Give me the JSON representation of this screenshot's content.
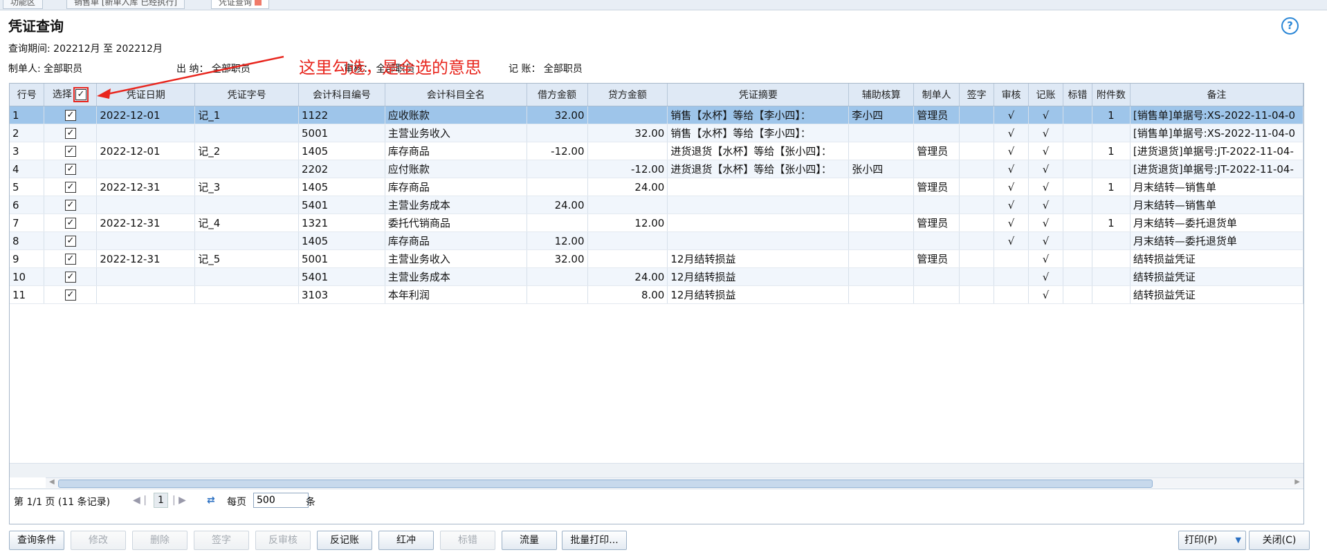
{
  "tabs": [
    {
      "label": "功能区"
    },
    {
      "label": "销售单 [新单入库 已经执行]"
    },
    {
      "label": "凭证查询"
    }
  ],
  "page_title": "凭证查询",
  "filters": {
    "period_label": "查询期间:",
    "period_value": "202212月 至 202212月",
    "maker_label": "制单人:",
    "maker_value": "全部职员",
    "cashier_label": "出 纳：",
    "cashier_value": "全部职员",
    "auditor_label": "审核：",
    "auditor_value": "全部职员",
    "poster_label": "记 账：",
    "poster_value": "全部职员"
  },
  "annotation": "这里勾选，是全选的意思",
  "colors": {
    "annotation": "#e8261e",
    "selected_row": "#9ec5ea",
    "header_bg": "#dfe9f5"
  },
  "columns": [
    "行号",
    "选择",
    "凭证日期",
    "凭证字号",
    "会计科目编号",
    "会计科目全名",
    "借方金额",
    "贷方金额",
    "凭证摘要",
    "辅助核算",
    "制单人",
    "签字",
    "审核",
    "记账",
    "标错",
    "附件数",
    "备注"
  ],
  "rows": [
    {
      "no": "1",
      "date": "2022-12-01",
      "voucher": "记_1",
      "code": "1122",
      "account": "应收账款",
      "debit": "32.00",
      "credit": "",
      "summary": "销售【水杯】等给【李小四】：",
      "aux": "李小四",
      "maker": "管理员",
      "sign": "",
      "audit": "√",
      "post": "√",
      "err": "",
      "attach": "1",
      "note": "[销售单]单据号:XS-2022-11-04-0"
    },
    {
      "no": "2",
      "date": "",
      "voucher": "",
      "code": "5001",
      "account": "主营业务收入",
      "debit": "",
      "credit": "32.00",
      "summary": "销售【水杯】等给【李小四】：",
      "aux": "",
      "maker": "",
      "sign": "",
      "audit": "√",
      "post": "√",
      "err": "",
      "attach": "",
      "note": "[销售单]单据号:XS-2022-11-04-0"
    },
    {
      "no": "3",
      "date": "2022-12-01",
      "voucher": "记_2",
      "code": "1405",
      "account": "库存商品",
      "debit": "-12.00",
      "credit": "",
      "summary": "进货退货【水杯】等给【张小四】：",
      "aux": "",
      "maker": "管理员",
      "sign": "",
      "audit": "√",
      "post": "√",
      "err": "",
      "attach": "1",
      "note": "[进货退货]单据号:JT-2022-11-04-"
    },
    {
      "no": "4",
      "date": "",
      "voucher": "",
      "code": "2202",
      "account": "应付账款",
      "debit": "",
      "credit": "-12.00",
      "summary": "进货退货【水杯】等给【张小四】：",
      "aux": "张小四",
      "maker": "",
      "sign": "",
      "audit": "√",
      "post": "√",
      "err": "",
      "attach": "",
      "note": "[进货退货]单据号:JT-2022-11-04-"
    },
    {
      "no": "5",
      "date": "2022-12-31",
      "voucher": "记_3",
      "code": "1405",
      "account": "库存商品",
      "debit": "",
      "credit": "24.00",
      "summary": "",
      "aux": "",
      "maker": "管理员",
      "sign": "",
      "audit": "√",
      "post": "√",
      "err": "",
      "attach": "1",
      "note": "月末结转—销售单"
    },
    {
      "no": "6",
      "date": "",
      "voucher": "",
      "code": "5401",
      "account": "主营业务成本",
      "debit": "24.00",
      "credit": "",
      "summary": "",
      "aux": "",
      "maker": "",
      "sign": "",
      "audit": "√",
      "post": "√",
      "err": "",
      "attach": "",
      "note": "月末结转—销售单"
    },
    {
      "no": "7",
      "date": "2022-12-31",
      "voucher": "记_4",
      "code": "1321",
      "account": "委托代销商品",
      "debit": "",
      "credit": "12.00",
      "summary": "",
      "aux": "",
      "maker": "管理员",
      "sign": "",
      "audit": "√",
      "post": "√",
      "err": "",
      "attach": "1",
      "note": "月末结转—委托退货单"
    },
    {
      "no": "8",
      "date": "",
      "voucher": "",
      "code": "1405",
      "account": "库存商品",
      "debit": "12.00",
      "credit": "",
      "summary": "",
      "aux": "",
      "maker": "",
      "sign": "",
      "audit": "√",
      "post": "√",
      "err": "",
      "attach": "",
      "note": "月末结转—委托退货单"
    },
    {
      "no": "9",
      "date": "2022-12-31",
      "voucher": "记_5",
      "code": "5001",
      "account": "主营业务收入",
      "debit": "32.00",
      "credit": "",
      "summary": "12月结转损益",
      "aux": "",
      "maker": "管理员",
      "sign": "",
      "audit": "",
      "post": "√",
      "err": "",
      "attach": "",
      "note": "结转损益凭证"
    },
    {
      "no": "10",
      "date": "",
      "voucher": "",
      "code": "5401",
      "account": "主营业务成本",
      "debit": "",
      "credit": "24.00",
      "summary": "12月结转损益",
      "aux": "",
      "maker": "",
      "sign": "",
      "audit": "",
      "post": "√",
      "err": "",
      "attach": "",
      "note": "结转损益凭证"
    },
    {
      "no": "11",
      "date": "",
      "voucher": "",
      "code": "3103",
      "account": "本年利润",
      "debit": "",
      "credit": "8.00",
      "summary": "12月结转损益",
      "aux": "",
      "maker": "",
      "sign": "",
      "audit": "",
      "post": "√",
      "err": "",
      "attach": "",
      "note": "结转损益凭证"
    }
  ],
  "checkbox_mark": "✓",
  "pager": {
    "page_info": "第 1/1 页 (11 条记录)",
    "current_page": "1",
    "per_page_label": "每页",
    "per_page_value": "500",
    "per_page_unit": "条"
  },
  "toolbar": {
    "query": "查询条件",
    "edit": "修改",
    "delete": "删除",
    "sign": "签字",
    "unaudit": "反审核",
    "unpost": "反记账",
    "red": "红冲",
    "mark_error": "标错",
    "flow": "流量",
    "batch_print": "批量打印...",
    "print": "打印(P)",
    "close": "关闭(C)"
  },
  "icons": {
    "help": "help-icon",
    "refresh": "refresh-icon",
    "dropdown": "chevron-down-icon"
  }
}
